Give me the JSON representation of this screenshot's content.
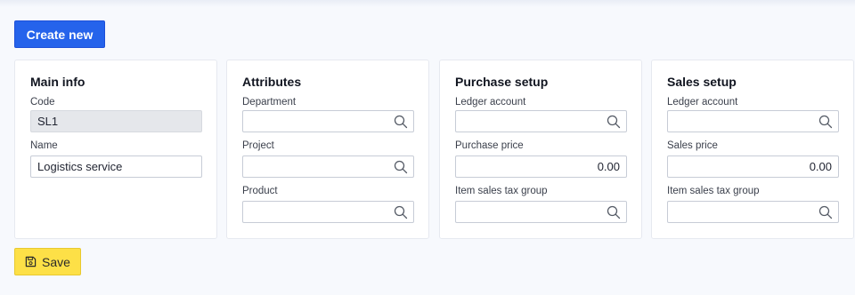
{
  "toolbar": {
    "create_label": "Create new",
    "save_label": "Save"
  },
  "main_info": {
    "title": "Main info",
    "code_label": "Code",
    "code_value": "SL1",
    "name_label": "Name",
    "name_value": "Logistics service"
  },
  "attributes": {
    "title": "Attributes",
    "department_label": "Department",
    "department_value": "",
    "project_label": "Project",
    "project_value": "",
    "product_label": "Product",
    "product_value": ""
  },
  "purchase_setup": {
    "title": "Purchase setup",
    "ledger_label": "Ledger account",
    "ledger_value": "",
    "price_label": "Purchase price",
    "price_value": "0.00",
    "tax_label": "Item sales tax group",
    "tax_value": ""
  },
  "sales_setup": {
    "title": "Sales setup",
    "ledger_label": "Ledger account",
    "ledger_value": "",
    "price_label": "Sales price",
    "price_value": "0.00",
    "tax_label": "Item sales tax group",
    "tax_value": ""
  },
  "icons": {
    "lookup": "search-icon",
    "save": "floppy-disk-icon"
  },
  "colors": {
    "primary": "#2563eb",
    "save": "#fde047"
  }
}
